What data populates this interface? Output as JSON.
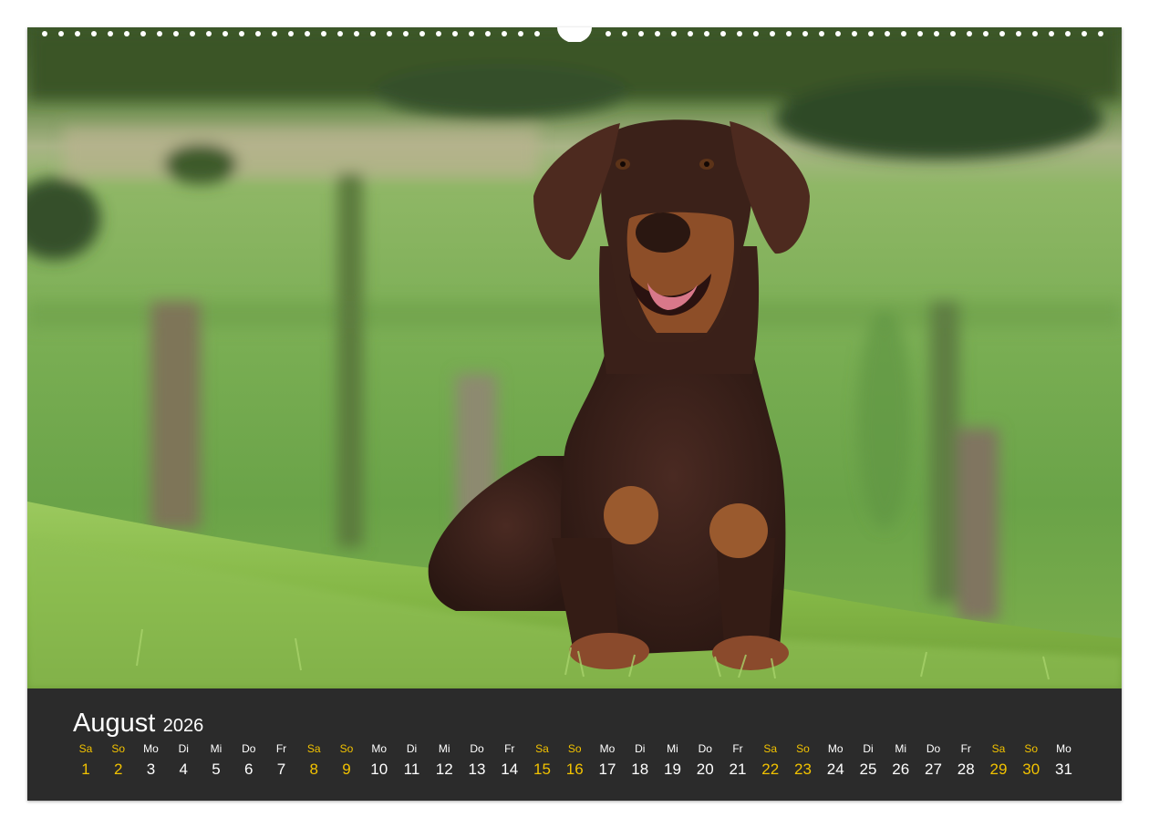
{
  "calendar": {
    "month": "August",
    "year": "2026",
    "days": [
      {
        "dow": "Sa",
        "num": "1"
      },
      {
        "dow": "So",
        "num": "2"
      },
      {
        "dow": "Mo",
        "num": "3"
      },
      {
        "dow": "Di",
        "num": "4"
      },
      {
        "dow": "Mi",
        "num": "5"
      },
      {
        "dow": "Do",
        "num": "6"
      },
      {
        "dow": "Fr",
        "num": "7"
      },
      {
        "dow": "Sa",
        "num": "8"
      },
      {
        "dow": "So",
        "num": "9"
      },
      {
        "dow": "Mo",
        "num": "10"
      },
      {
        "dow": "Di",
        "num": "11"
      },
      {
        "dow": "Mi",
        "num": "12"
      },
      {
        "dow": "Do",
        "num": "13"
      },
      {
        "dow": "Fr",
        "num": "14"
      },
      {
        "dow": "Sa",
        "num": "15"
      },
      {
        "dow": "So",
        "num": "16"
      },
      {
        "dow": "Mo",
        "num": "17"
      },
      {
        "dow": "Di",
        "num": "18"
      },
      {
        "dow": "Mi",
        "num": "19"
      },
      {
        "dow": "Do",
        "num": "20"
      },
      {
        "dow": "Fr",
        "num": "21"
      },
      {
        "dow": "Sa",
        "num": "22"
      },
      {
        "dow": "So",
        "num": "23"
      },
      {
        "dow": "Mo",
        "num": "24"
      },
      {
        "dow": "Di",
        "num": "25"
      },
      {
        "dow": "Mi",
        "num": "26"
      },
      {
        "dow": "Do",
        "num": "27"
      },
      {
        "dow": "Fr",
        "num": "28"
      },
      {
        "dow": "Sa",
        "num": "29"
      },
      {
        "dow": "So",
        "num": "30"
      },
      {
        "dow": "Mo",
        "num": "31"
      }
    ]
  },
  "colors": {
    "weekend": "#f2c200",
    "weekday": "#ffffff",
    "calendar_bg": "#2b2b2b"
  }
}
